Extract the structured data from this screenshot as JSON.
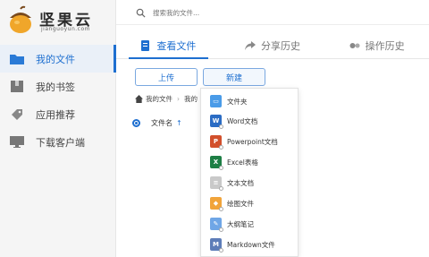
{
  "logo": {
    "title": "坚果云",
    "subtitle": "jianguoyun.com"
  },
  "search": {
    "placeholder": "搜索我的文件..."
  },
  "sidebar": {
    "items": [
      {
        "label": "我的文件",
        "icon": "folder-icon",
        "active": true
      },
      {
        "label": "我的书签",
        "icon": "bookmark-icon",
        "active": false
      },
      {
        "label": "应用推荐",
        "icon": "tag-icon",
        "active": false
      },
      {
        "label": "下载客户端",
        "icon": "monitor-icon",
        "active": false
      }
    ]
  },
  "tabs": [
    {
      "label": "查看文件",
      "icon": "file-icon",
      "active": true
    },
    {
      "label": "分享历史",
      "icon": "share-icon",
      "active": false
    },
    {
      "label": "操作历史",
      "icon": "history-icon",
      "active": false
    }
  ],
  "toolbar": {
    "upload_label": "上传",
    "new_label": "新建"
  },
  "breadcrumb": {
    "home": "我的文件",
    "current": "我的"
  },
  "table": {
    "name_header": "文件名"
  },
  "dropdown": {
    "items": [
      {
        "label": "文件夹",
        "icon": "folder-icon",
        "color": "#4a9be8"
      },
      {
        "label": "Word文档",
        "icon": "word-icon",
        "color": "#2b6cc4"
      },
      {
        "label": "Powerpoint文档",
        "icon": "powerpoint-icon",
        "color": "#d2502c"
      },
      {
        "label": "Excel表格",
        "icon": "excel-icon",
        "color": "#1e7f45"
      },
      {
        "label": "文本文档",
        "icon": "text-file-icon",
        "color": "#c9c9c9"
      },
      {
        "label": "绘图文件",
        "icon": "drawing-icon",
        "color": "#f1a43b"
      },
      {
        "label": "大纲笔记",
        "icon": "outline-note-icon",
        "color": "#6fa6e6"
      },
      {
        "label": "Markdown文件",
        "icon": "markdown-icon",
        "color": "#5d7db8"
      }
    ]
  },
  "colors": {
    "accent": "#1e6fd0"
  }
}
